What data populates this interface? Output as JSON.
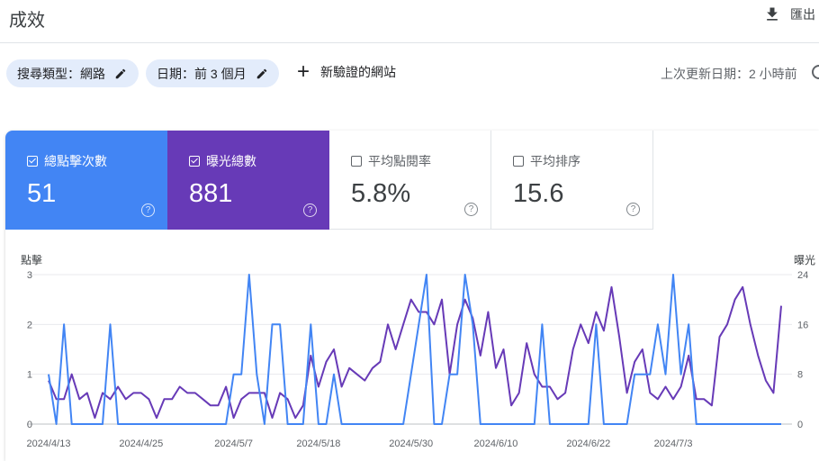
{
  "header": {
    "title": "成效",
    "export_label": "匯出"
  },
  "filters": {
    "search_type": "搜尋類型：網路",
    "date": "日期：前 3 個月",
    "new_label": "新驗證的網站"
  },
  "updated": "上次更新日期：2 小時前",
  "metrics": [
    {
      "label": "總點擊次數",
      "value": "51",
      "checked": true,
      "color": "#4285f4"
    },
    {
      "label": "曝光總數",
      "value": "881",
      "checked": true,
      "color": "#673ab7"
    },
    {
      "label": "平均點閱率",
      "value": "5.8%",
      "checked": false
    },
    {
      "label": "平均排序",
      "value": "15.6",
      "checked": false
    }
  ],
  "chart_data": {
    "type": "line",
    "left_axis_title": "點擊",
    "right_axis_title": "曝光",
    "left_ylim": [
      0,
      3
    ],
    "right_ylim": [
      0,
      24
    ],
    "left_ticks": [
      "0",
      "1",
      "2",
      "3"
    ],
    "right_ticks": [
      "0",
      "8",
      "16",
      "24"
    ],
    "x_tick_labels": [
      "2024/4/13",
      "2024/4/25",
      "2024/5/7",
      "2024/5/18",
      "2024/5/30",
      "2024/6/10",
      "2024/6/22",
      "2024/7/3"
    ],
    "x_tick_day_index": [
      0,
      12,
      24,
      35,
      47,
      58,
      70,
      81
    ],
    "grid": true,
    "series": [
      {
        "name": "點擊",
        "axis": "left",
        "color": "#4285f4",
        "values": [
          1,
          0,
          2,
          0,
          0,
          0,
          0,
          0,
          2,
          0,
          0,
          0,
          0,
          0,
          0,
          0,
          0,
          0,
          0,
          0,
          0,
          0,
          0,
          0,
          1,
          1,
          3,
          1,
          0,
          2,
          2,
          0,
          0,
          0,
          2,
          0,
          0,
          1,
          0,
          0,
          0,
          0,
          0,
          0,
          0,
          0,
          0,
          1,
          2,
          3,
          0,
          0,
          1,
          1,
          3,
          2,
          0,
          0,
          0,
          0,
          0,
          0,
          0,
          0,
          2,
          0,
          0,
          0,
          0,
          0,
          0,
          2,
          0,
          0,
          0,
          0,
          1,
          1,
          1,
          2,
          1,
          3,
          1,
          2,
          0,
          0,
          0,
          0,
          0,
          0,
          0,
          0,
          0,
          0,
          0,
          0
        ]
      },
      {
        "name": "曝光",
        "axis": "right",
        "color": "#673ab7",
        "values": [
          7,
          4,
          4,
          8,
          4,
          5,
          1,
          5,
          4,
          6,
          4,
          5,
          5,
          4,
          1,
          4,
          4,
          6,
          5,
          5,
          4,
          3,
          3,
          6,
          1,
          4,
          5,
          5,
          5,
          1,
          5,
          4,
          1,
          3,
          11,
          6,
          10,
          12,
          6,
          9,
          8,
          7,
          9,
          10,
          16,
          12,
          16,
          20,
          18,
          18,
          16,
          20,
          8,
          16,
          20,
          17,
          11,
          18,
          9,
          12,
          3,
          5,
          13,
          8,
          6,
          6,
          4,
          5,
          12,
          16,
          13,
          18,
          15,
          22,
          14,
          5,
          10,
          12,
          5,
          4,
          6,
          4,
          6,
          11,
          4,
          4,
          3,
          14,
          16,
          20,
          22,
          16,
          11,
          7,
          5,
          19
        ]
      }
    ]
  }
}
